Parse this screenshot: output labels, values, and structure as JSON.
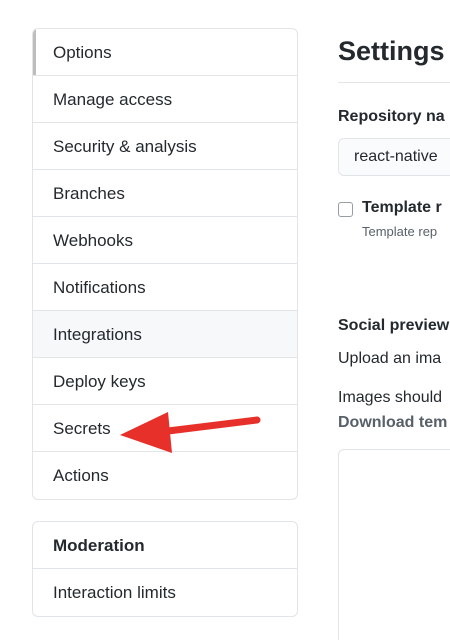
{
  "sidebar": {
    "items": [
      {
        "label": "Options",
        "name": "sidebar-item-options",
        "selected": true
      },
      {
        "label": "Manage access",
        "name": "sidebar-item-manage-access"
      },
      {
        "label": "Security & analysis",
        "name": "sidebar-item-security-analysis"
      },
      {
        "label": "Branches",
        "name": "sidebar-item-branches"
      },
      {
        "label": "Webhooks",
        "name": "sidebar-item-webhooks"
      },
      {
        "label": "Notifications",
        "name": "sidebar-item-notifications"
      },
      {
        "label": "Integrations",
        "name": "sidebar-item-integrations",
        "hovered": true
      },
      {
        "label": "Deploy keys",
        "name": "sidebar-item-deploy-keys"
      },
      {
        "label": "Secrets",
        "name": "sidebar-item-secrets"
      },
      {
        "label": "Actions",
        "name": "sidebar-item-actions"
      }
    ]
  },
  "moderation": {
    "heading": "Moderation",
    "items": [
      {
        "label": "Interaction limits",
        "name": "sidebar-item-interaction-limits"
      }
    ]
  },
  "main": {
    "title": "Settings",
    "repository_label": "Repository na",
    "repository_value": "react-native",
    "template_label": "Template r",
    "template_description": "Template rep",
    "social_preview_heading": "Social preview",
    "upload_text": "Upload an ima",
    "images_text": "Images should",
    "download_link": "Download tem"
  },
  "colors": {
    "annotation_arrow": "#e8302a",
    "border": "#e1e4e8",
    "selected_indicator": "#bdbdbd"
  }
}
